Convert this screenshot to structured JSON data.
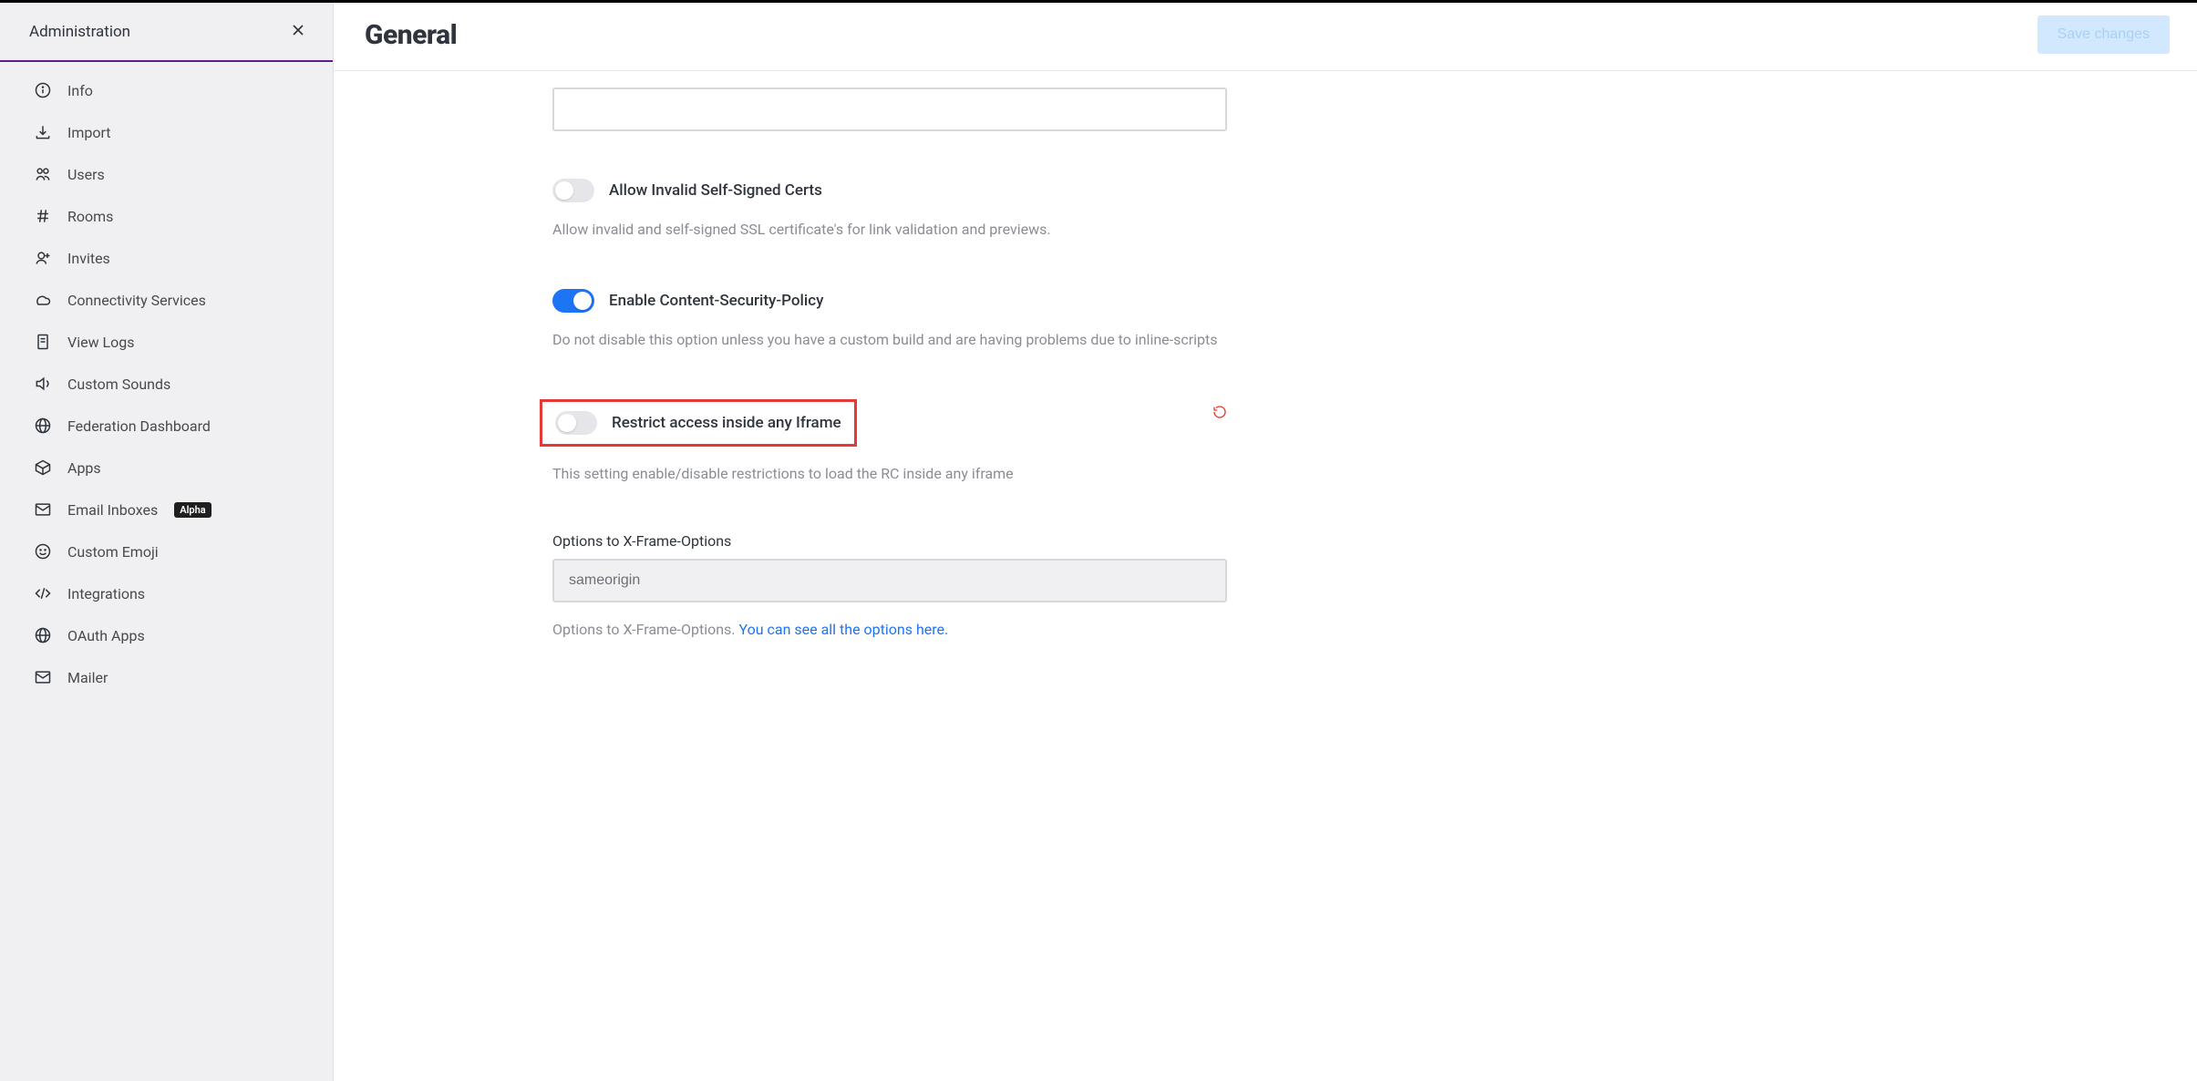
{
  "sidebar": {
    "title": "Administration",
    "items": [
      {
        "label": "Info"
      },
      {
        "label": "Import"
      },
      {
        "label": "Users"
      },
      {
        "label": "Rooms"
      },
      {
        "label": "Invites"
      },
      {
        "label": "Connectivity Services"
      },
      {
        "label": "View Logs"
      },
      {
        "label": "Custom Sounds"
      },
      {
        "label": "Federation Dashboard"
      },
      {
        "label": "Apps"
      },
      {
        "label": "Email Inboxes",
        "badge": "Alpha"
      },
      {
        "label": "Custom Emoji"
      },
      {
        "label": "Integrations"
      },
      {
        "label": "OAuth Apps"
      },
      {
        "label": "Mailer"
      }
    ]
  },
  "header": {
    "title": "General",
    "save_label": "Save changes"
  },
  "settings": {
    "allow_invalid_certs": {
      "label": "Allow Invalid Self-Signed Certs",
      "enabled": false,
      "description": "Allow invalid and self-signed SSL certificate's for link validation and previews."
    },
    "enable_csp": {
      "label": "Enable Content-Security-Policy",
      "enabled": true,
      "description": "Do not disable this option unless you have a custom build and are having problems due to inline-scripts"
    },
    "restrict_iframe": {
      "label": "Restrict access inside any Iframe",
      "enabled": false,
      "description": "This setting enable/disable restrictions to load the RC inside any iframe"
    },
    "xframe": {
      "label": "Options to X-Frame-Options",
      "value": "sameorigin",
      "description_prefix": "Options to X-Frame-Options. ",
      "description_link": "You can see all the options here."
    }
  }
}
